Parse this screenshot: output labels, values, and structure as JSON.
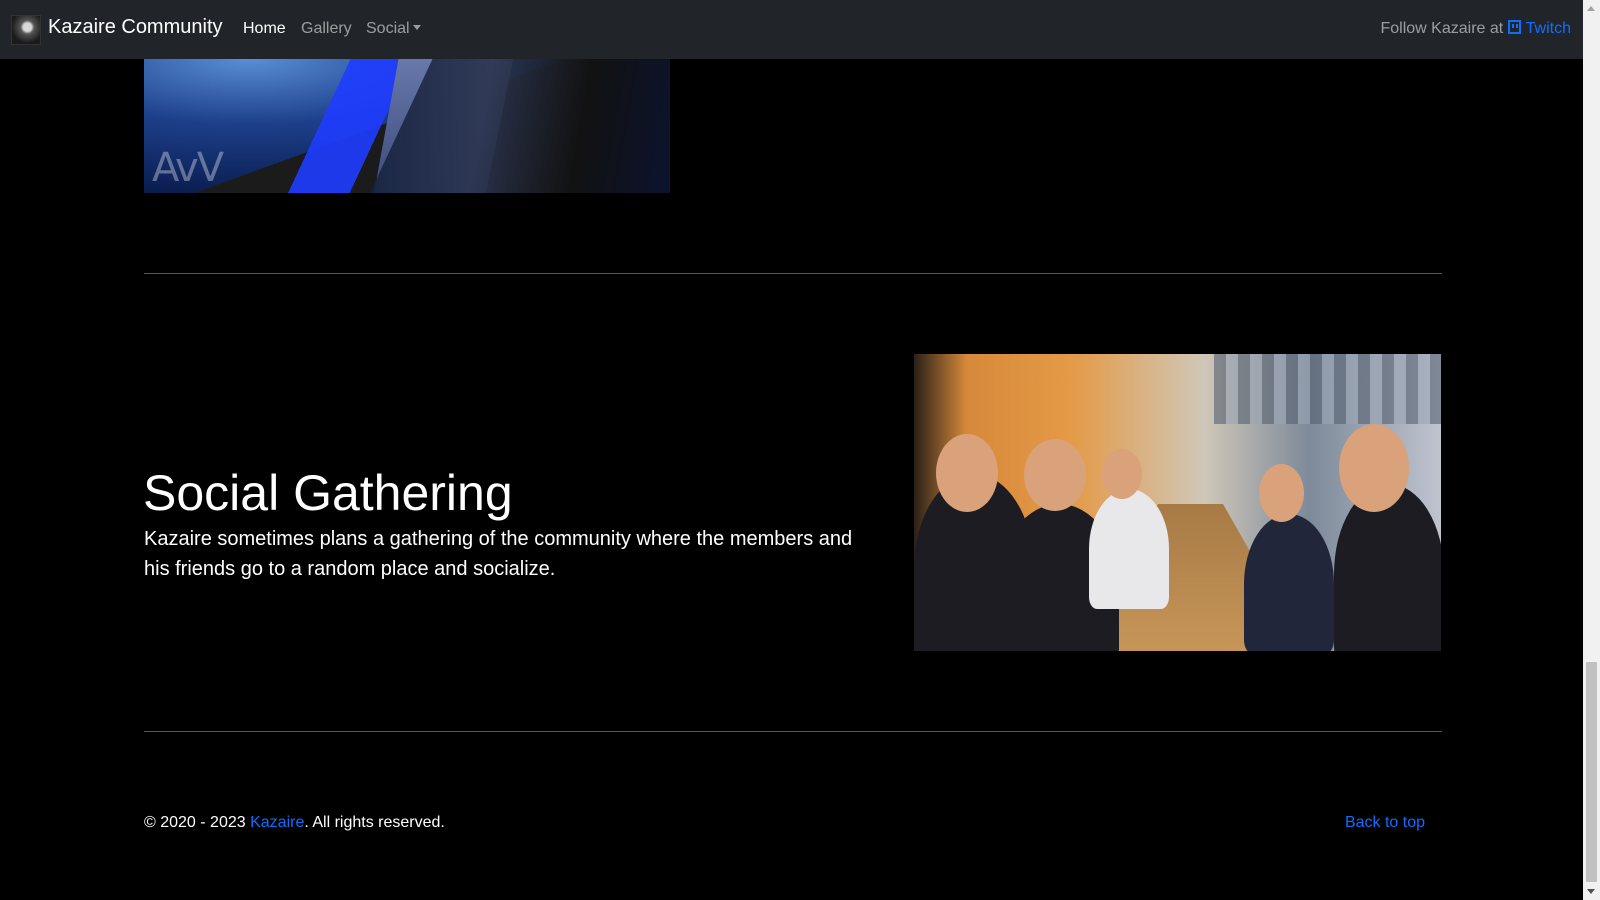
{
  "navbar": {
    "brand": "Kazaire Community",
    "links": [
      {
        "label": "Home",
        "active": true
      },
      {
        "label": "Gallery",
        "active": false
      },
      {
        "label": "Social",
        "active": false,
        "dropdown": true
      }
    ],
    "follow_prefix": "Follow Kazaire at",
    "twitch_label": "Twitch"
  },
  "sections": {
    "social": {
      "heading": "Social Gathering",
      "text": "Kazaire sometimes plans a gathering of the community where the members and his friends go to a random place and socialize."
    }
  },
  "footer": {
    "copy_prefix": "© 2020 - 2023",
    "owner_link": "Kazaire",
    "copy_suffix": ". All rights reserved.",
    "back_to_top": "Back to top"
  },
  "colors": {
    "navbar_bg": "#212529",
    "page_bg": "#000000",
    "link": "#0d6efd"
  }
}
